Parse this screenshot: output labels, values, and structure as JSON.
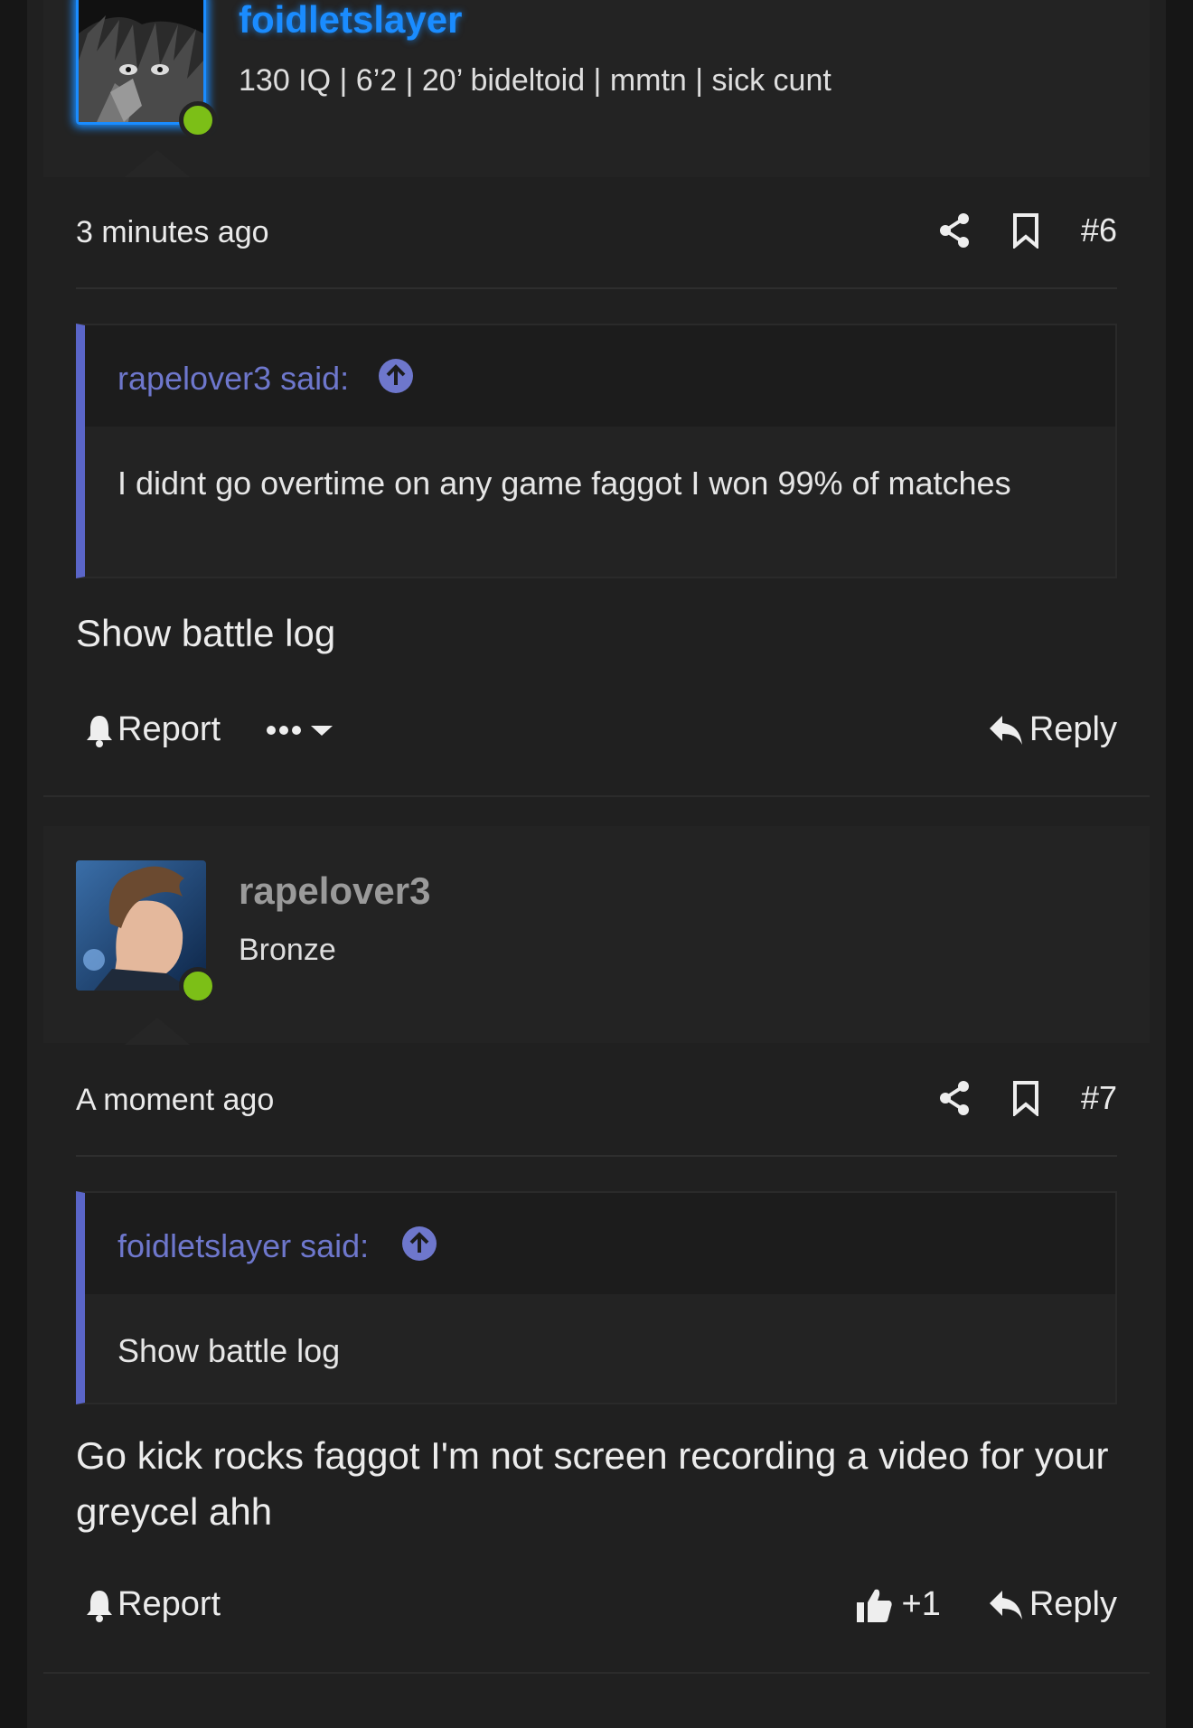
{
  "posts": [
    {
      "username": "foidletslayer",
      "user_title": "130 IQ | 6’2 | 20’ bideltoid | mmtn | sick cunt",
      "time": "3 minutes ago",
      "post_number": "#6",
      "quote": {
        "author": "rapelover3 said:",
        "text": "I didnt go overtime on any game faggot I won 99% of matches"
      },
      "message": "Show battle log",
      "report_label": "Report",
      "reply_label": "Reply"
    },
    {
      "username": "rapelover3",
      "user_title": "Bronze",
      "time": "A moment ago",
      "post_number": "#7",
      "quote": {
        "author": "foidletslayer said:",
        "text": "Show battle log"
      },
      "message": "Go kick rocks faggot I'm not screen recording a video for your greycel ahh",
      "report_label": "Report",
      "reaction_count": "+1",
      "reply_label": "Reply"
    }
  ],
  "colors": {
    "accent_blue": "#1a8cff",
    "quote_bar": "#5a65c8",
    "online": "#7cbf17"
  }
}
